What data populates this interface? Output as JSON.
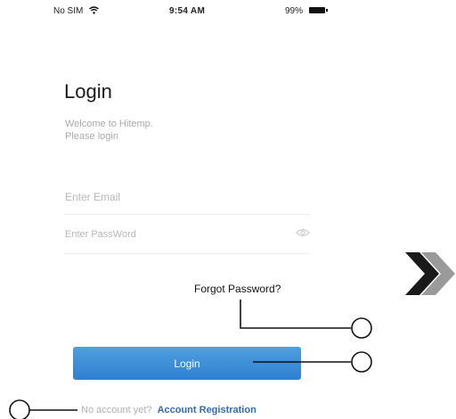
{
  "status_bar": {
    "carrier": "No SIM",
    "time": "9:54 AM",
    "battery": "99%"
  },
  "login": {
    "title": "Login",
    "welcome_line1": "Welcome to Hitemp.",
    "welcome_line2": "Please login",
    "email_placeholder": "Enter Email",
    "password_placeholder": "Enter PassWord",
    "forgot_password": "Forgot Password?",
    "login_button": "Login",
    "no_account_text": "No account yet?",
    "register_link": "Account Registration"
  },
  "icons": {
    "wifi": "wifi-icon",
    "battery": "battery-icon",
    "password_toggle": "eye-icon",
    "next": "double-chevron-right-icon"
  },
  "colors": {
    "button_blue": "#3a8bd8",
    "link_blue": "#2f6db8",
    "placeholder_gray": "#b6b6b6",
    "chevron_dark": "#1a1a1a",
    "chevron_light": "#9a9a9a"
  }
}
